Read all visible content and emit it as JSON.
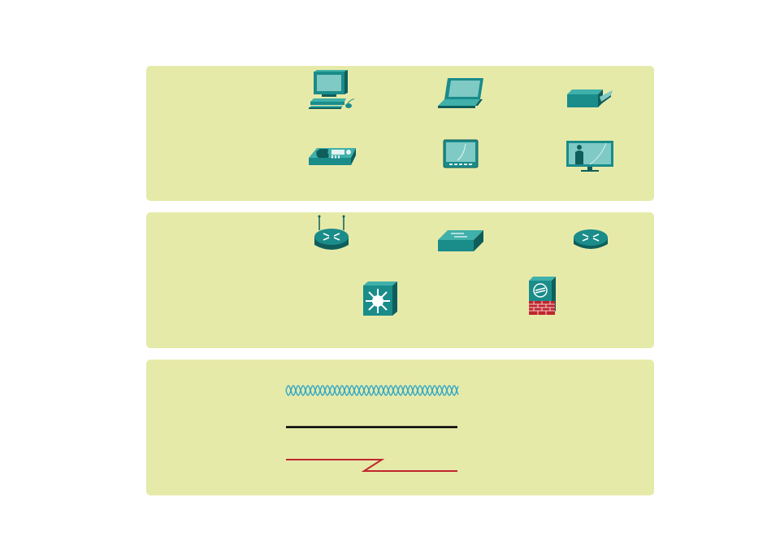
{
  "colors": {
    "panel": "#e6eaa9",
    "teal": "#1a8c8a",
    "teal_dark": "#0f5e5c",
    "teal_light": "#3fb0aa",
    "screen": "#7fcac4",
    "wireless": "#33a8c8",
    "lan_cable": "#000000",
    "wan_link": "#c0262d",
    "firewall_brick": "#c0262d"
  },
  "panels": {
    "end_devices": {
      "icons": [
        "desktop-pc",
        "laptop",
        "printer",
        "ip-phone",
        "tablet",
        "telepresence"
      ]
    },
    "intermediary_devices": {
      "icons": [
        "wireless-router",
        "lan-switch",
        "router",
        "multilayer-switch",
        "firewall-appliance"
      ]
    },
    "network_media": {
      "icons": [
        "wireless-media",
        "lan-media",
        "wan-media"
      ]
    }
  }
}
